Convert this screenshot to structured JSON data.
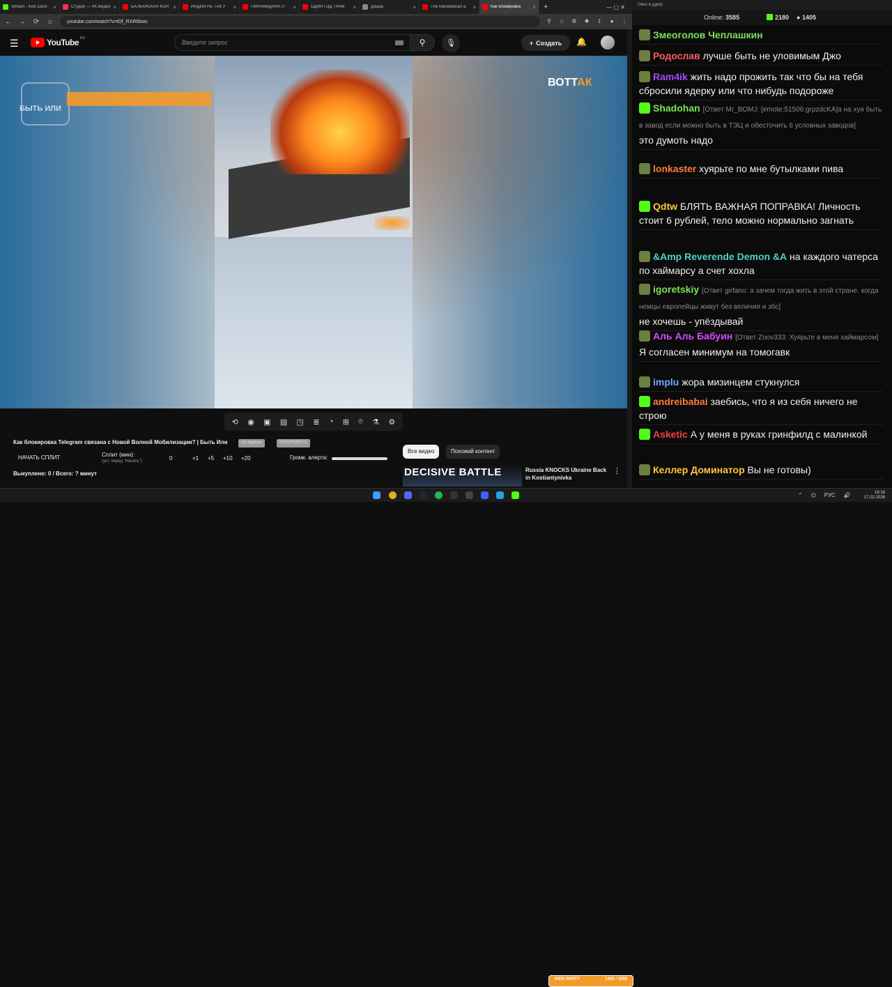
{
  "browser": {
    "tabs": [
      {
        "label": "Stream - Kick Dash",
        "color": "#53fc18"
      },
      {
        "label": "Студия — VK Видео",
        "color": "#ff2d55"
      },
      {
        "label": "БАЛКАНСКАЯ КОН",
        "color": "#ff0000"
      },
      {
        "label": "ИНДИЯ НЕ ТАК У",
        "color": "#ff0000"
      },
      {
        "label": "ПИРАМИДНАЯ Л",
        "color": "#ff0000"
      },
      {
        "label": "ОДИН ГОД ТРАМ",
        "color": "#ff0000"
      },
      {
        "label": "Дзыра",
        "color": "#888888"
      },
      {
        "label": "The Mandalorian a",
        "color": "#ff0000"
      },
      {
        "label": "Как блокировка",
        "color": "#ff0000"
      }
    ],
    "url": "youtube.com/watch?v=tDf_RXR6bws"
  },
  "youtube": {
    "logo": "YouTube",
    "region": "RU",
    "search_placeholder": "Введите запрос",
    "create_label": "Создать"
  },
  "video": {
    "watermark_left": "БЫТЬ ИЛИ",
    "watermark_right_a": "ВОТ",
    "watermark_right_b": "АК",
    "title": "Как блокировка Telegram связана с Новой Волной Мобилизации? | Быть Или",
    "pill1": "На вудишь",
    "pill2": "КОПИРОВАТЬ"
  },
  "split": {
    "start": "НАЧАТЬ СПЛИТ",
    "label": "Сплит (мин):",
    "sublabel": "(уст. перед \"Начать\")",
    "val0": "0",
    "p1": "+1",
    "p5": "+5",
    "p10": "+10",
    "p20": "+20",
    "volume": "Громк. алерта:",
    "bought": "Выкуплено: 0 / Всего: ? минут"
  },
  "recs": {
    "chip_all": "Все видео",
    "chip_similar": "Похожий контент",
    "thumb_text": "DECISIVE BATTLE",
    "title": "Russia KNOCKS Ukraine Back in Kostiantynivka"
  },
  "chat": {
    "window_title": "Окно в дурку",
    "online_label": "Online:",
    "online": "3585",
    "k1": "2180",
    "k2": "1405",
    "messages": [
      {
        "name": "Змеоголов Чеплашкин",
        "color": "#7ee05a",
        "text": "",
        "reply": "",
        "badge": "sub"
      },
      {
        "name": "Родослав",
        "color": "#ff5c5c",
        "text": "лучше быть не уловимым Джо",
        "reply": "",
        "badge": "sub"
      },
      {
        "name": "Ram4ik",
        "color": "#a24bff",
        "text": "жить надо прожить так что бы на тебя сбросили ядерку или что нибудь подороже",
        "reply": "",
        "badge": "sub"
      },
      {
        "name": "Shadohan",
        "color": "#7ee05a",
        "text": "это думоть надо",
        "reply": "[Ответ Mr_BOMJ: [emote:51506:grpzdcKA]а на хуя быть в завод если можно быть в ТЭЦ и обесточить 6 условных заводов]",
        "badge": "k"
      },
      {
        "name": "lonkaster",
        "color": "#ff7a3d",
        "text": "хуярьте по мне бутылками пива",
        "reply": "",
        "badge": "sub"
      },
      {
        "name": "Qdtw",
        "color": "#ffc83d",
        "text": "БЛЯТЬ ВАЖНАЯ ПОПРАВКА! Личность стоит 6 рублей, тело можно нормально загнать",
        "reply": "",
        "badge": "k"
      },
      {
        "name": "&Amp Reverende Demon &A",
        "color": "#4fd3c4",
        "text": "на каждого чатерса по хаймарсу а счет хохла",
        "reply": "",
        "badge": "sub"
      },
      {
        "name": "igoretskiy",
        "color": "#7ee05a",
        "text": "не хочешь - упёздывай",
        "reply": "[Ответ girfano: а зачем тогда жить в этой стране. когда немцы европейцы живут без величия и збс]",
        "badge": "sub"
      },
      {
        "name": "Аль Аль Бабуин",
        "color": "#d84bff",
        "text": "Я согласен минимум на томогавк",
        "reply": "[Ответ Zoov333: Хуярьте в меня хаймарсом]",
        "badge": "sub"
      },
      {
        "name": "implu",
        "color": "#6fa8ff",
        "text": "жора мизинцем стукнулся",
        "reply": "",
        "badge": "sub"
      },
      {
        "name": "andreibabai",
        "color": "#ff7a3d",
        "text": "заебись, что я из себя ничего не строю",
        "reply": "",
        "badge": "k"
      },
      {
        "name": "Asketic",
        "color": "#ff3d3d",
        "text": "А у меня в руках гринфилд с малинкой",
        "reply": "",
        "badge": "k"
      },
      {
        "name": "Келлер Доминатор",
        "color": "#ffc83d",
        "text": "Вы не готовы)",
        "reply": "",
        "badge": "sub"
      }
    ]
  },
  "taskbar": {
    "kick_party": "KICK PARTY",
    "kick_progress": "1400 / 1500",
    "lang": "РУС",
    "time": "18:18",
    "date": "17.02.2026"
  }
}
